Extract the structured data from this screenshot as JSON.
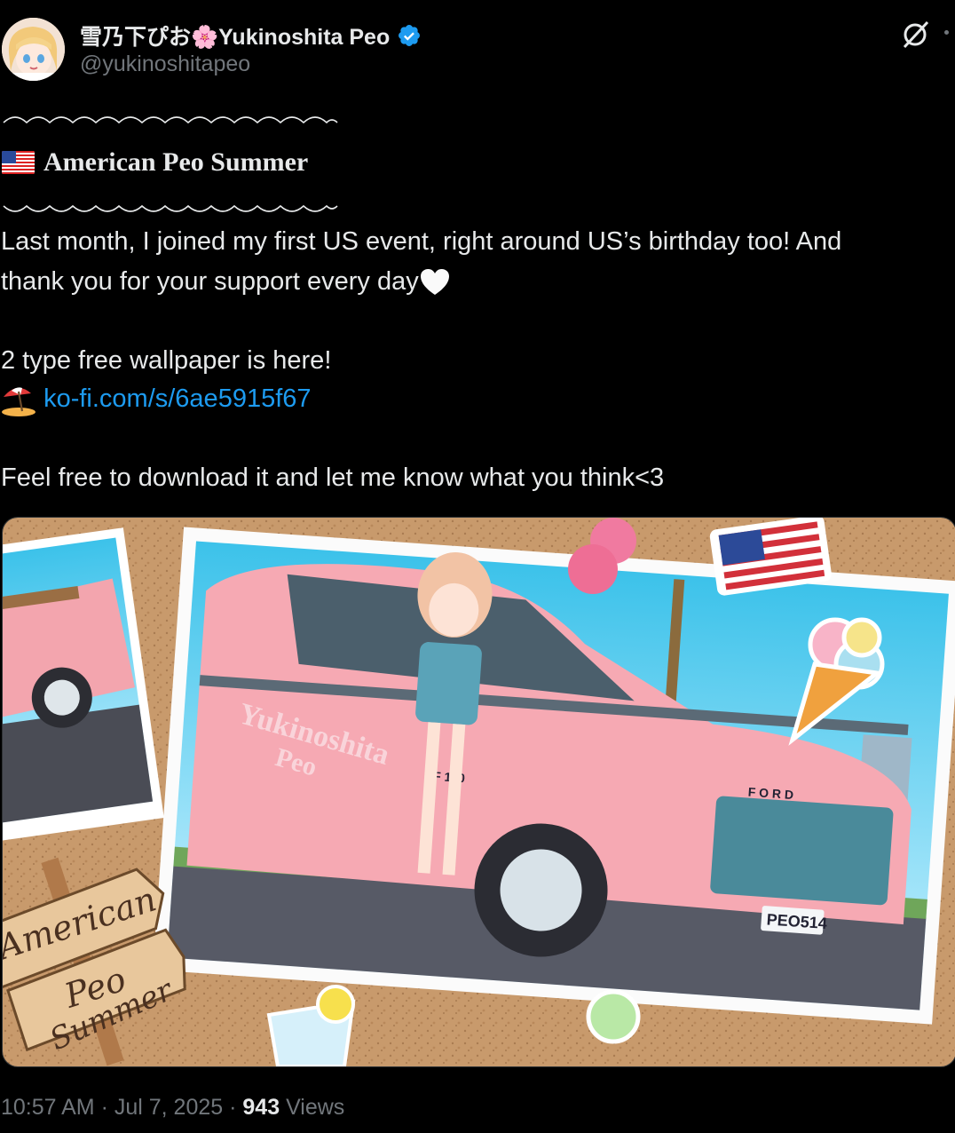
{
  "author": {
    "display_name": "雪乃下ぴお🌸Yukinoshita Peo",
    "handle": "@yukinoshitapeo",
    "verified_icon": "verified-badge-icon",
    "avatar_icon": "avatar"
  },
  "header_actions": {
    "grok_icon": "grok-icon",
    "more_icon": "more-icon"
  },
  "post": {
    "title": "American Peo Summer",
    "line1": "Last month, I joined my first US event, right around US’s birthday too! And",
    "line2": "thank you for your support every day",
    "line3": "2 type free wallpaper is here!",
    "link": "ko-fi.com/s/6ae5915f67",
    "line4": "Feel free to download it and let me know what you think<3"
  },
  "media": {
    "sign_text_1": "American",
    "sign_text_2": "Peo",
    "sign_text_3": "Summer",
    "car_text_1": "Yukinoshita",
    "car_text_2": "Peo",
    "plate": "PEO514",
    "model": "F 150",
    "grille": "F O R D"
  },
  "meta": {
    "time": "10:57 AM",
    "sep1": " · ",
    "date": "Jul 7, 2025",
    "sep2": " · ",
    "views_count": "943",
    "views_label": " Views"
  },
  "colors": {
    "background": "#000000",
    "text": "#e7e9ea",
    "muted": "#71767b",
    "link": "#1d9bf0",
    "verified": "#1d9bf0"
  }
}
